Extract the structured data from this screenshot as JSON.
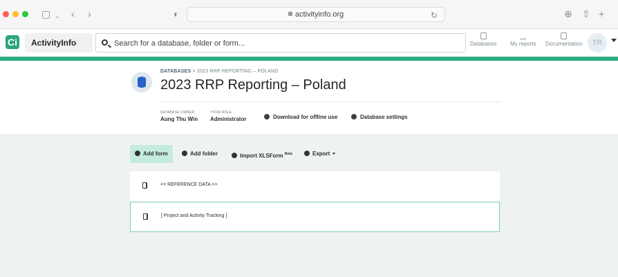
{
  "browser": {
    "url": "activityinfo.org",
    "icons": [
      "sidebar-icon",
      "chevron-down-icon",
      "back-icon",
      "forward-icon",
      "privacy-shield-icon",
      "reload-icon",
      "download-icon",
      "share-icon",
      "new-tab-icon"
    ]
  },
  "app": {
    "logo_letter": "Ci",
    "name": "ActivityInfo",
    "search_placeholder": "Search for a database, folder or form...",
    "nav": {
      "databases": "Databases",
      "my_reports": "My reports",
      "documentation": "Documentation"
    },
    "avatar_initials": "TR"
  },
  "database": {
    "breadcrumb_root": "DATABASES",
    "breadcrumb_sep": ">",
    "breadcrumb_current": "2023 RRP REPORTING – POLAND",
    "title": "2023 RRP Reporting – Poland",
    "owner_label": "DATABASE OWNER",
    "owner_value": "Aung Thu Win",
    "role_label": "YOUR ROLE",
    "role_value": "Administrator",
    "download_label": "Download for offline use",
    "settings_label": "Database settings"
  },
  "toolbar": {
    "add_form": "Add form",
    "add_folder": "Add folder",
    "import_xlsform": "Import XLSForm",
    "import_badge": "Beta",
    "export": "Export"
  },
  "forms": [
    {
      "label": "<< REFERENCE DATA >>"
    },
    {
      "label": "[ Project and Activity Tracking ]"
    }
  ],
  "colors": {
    "brand_green": "#2fae86",
    "primary_button_bg": "#c4ecdc",
    "database_icon": "#2563c9"
  }
}
